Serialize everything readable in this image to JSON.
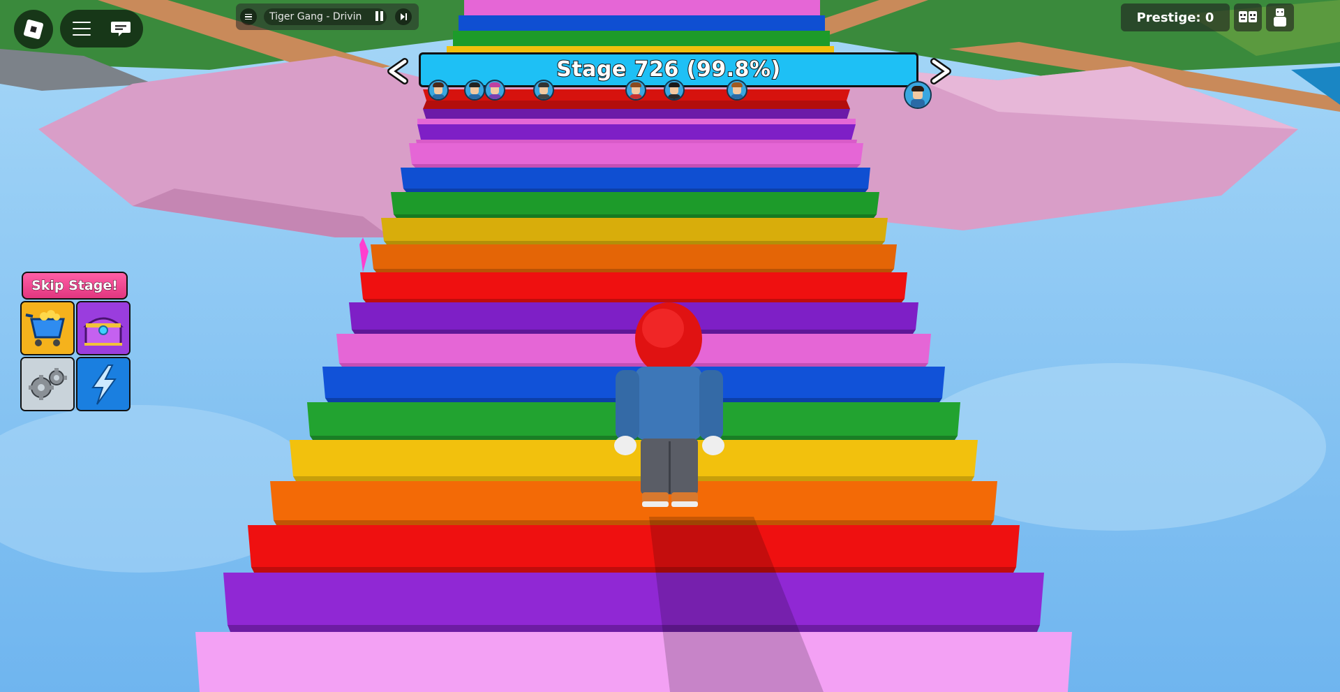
{
  "music_player": {
    "track_title": "Tiger Gang - Drivin",
    "menu_icon": "hamburger-icon",
    "pause_icon": "pause-icon",
    "skip_icon": "skip-forward-icon"
  },
  "stage_bar": {
    "label": "Stage 726 (99.8%)",
    "stage": 726,
    "progress_percent": 99.8,
    "fill_color": "#1ec0f5",
    "prev_icon": "chevron-left-icon",
    "next_icon": "chevron-right-icon"
  },
  "prestige": {
    "label": "Prestige: 0"
  },
  "left_menu": {
    "skip_stage_label": "Skip Stage!",
    "skip_stage_color": "#f04a93",
    "tiles": [
      {
        "name": "shop",
        "icon": "shopping-cart-icon",
        "color": "#f5b21c"
      },
      {
        "name": "chest",
        "icon": "treasure-chest-icon",
        "color": "#9a3dde"
      },
      {
        "name": "settings",
        "icon": "gear-icon",
        "color": "#c9d3da"
      },
      {
        "name": "boost",
        "icon": "lightning-icon",
        "color": "#1a7fe0"
      }
    ]
  },
  "stair_colors": [
    "#f3a1f4",
    "#7e1fc6",
    "#ef1010",
    "#f36a06",
    "#f2c10d",
    "#1d9b2a",
    "#0f4fd2",
    "#e566d6"
  ]
}
